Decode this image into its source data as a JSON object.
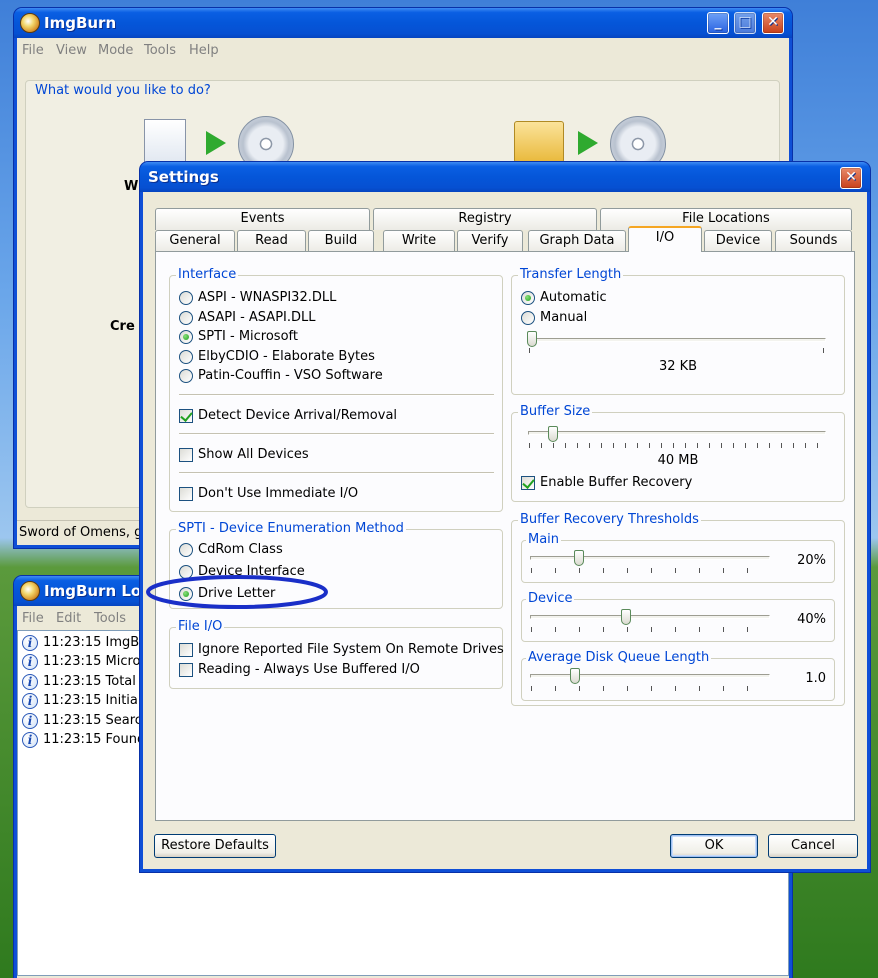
{
  "main_window": {
    "title": "ImgBurn",
    "menu": [
      "File",
      "View",
      "Mode",
      "Tools",
      "Help"
    ],
    "prompt": "What would you like to do?",
    "partial_label_1": "W",
    "partial_label_2": "Cre",
    "status_text": "Sword of Omens, giv"
  },
  "log_window": {
    "title": "ImgBurn Log",
    "menu": [
      "File",
      "Edit",
      "Tools"
    ],
    "entries": [
      "11:23:15 ImgBu",
      "11:23:15 Micros",
      "11:23:15 Total P",
      "11:23:15 Initialis",
      "11:23:15 Search",
      "11:23:15 Found"
    ]
  },
  "settings": {
    "title": "Settings",
    "tabs_row1": [
      "Events",
      "Registry",
      "File Locations"
    ],
    "tabs_row2": [
      "General",
      "Read",
      "Build",
      "Write",
      "Verify",
      "Graph Data",
      "I/O",
      "Device",
      "Sounds"
    ],
    "active_tab": "I/O",
    "interface": {
      "label": "Interface",
      "options": [
        "ASPI - WNASPI32.DLL",
        "ASAPI - ASAPI.DLL",
        "SPTI - Microsoft",
        "ElbyCDIO - Elaborate Bytes",
        "Patin-Couffin - VSO Software"
      ],
      "selected": "SPTI - Microsoft",
      "detect_arrival": "Detect Device Arrival/Removal",
      "show_all": "Show All Devices",
      "dont_use_immediate": "Don't Use Immediate I/O"
    },
    "spti": {
      "label": "SPTI - Device Enumeration Method",
      "options": [
        "CdRom Class",
        "Device Interface",
        "Drive Letter"
      ],
      "selected": "Drive Letter"
    },
    "file_io": {
      "label": "File I/O",
      "ignore_reported": "Ignore Reported File System On Remote Drives",
      "reading_buffered": "Reading - Always Use Buffered I/O"
    },
    "transfer_length": {
      "label": "Transfer Length",
      "automatic": "Automatic",
      "manual": "Manual",
      "value": "32 KB"
    },
    "buffer_size": {
      "label": "Buffer Size",
      "value": "40 MB",
      "enable_recovery": "Enable Buffer Recovery"
    },
    "thresholds": {
      "label": "Buffer Recovery Thresholds",
      "main_label": "Main",
      "main_value": "20%",
      "device_label": "Device",
      "device_value": "40%",
      "queue_label": "Average Disk Queue Length",
      "queue_value": "1.0"
    },
    "buttons": {
      "restore": "Restore Defaults",
      "ok": "OK",
      "cancel": "Cancel"
    }
  },
  "colors": {
    "group_label": "#0046d5",
    "title_bar": "#0556d9",
    "annotation": "#1a2fc8"
  }
}
